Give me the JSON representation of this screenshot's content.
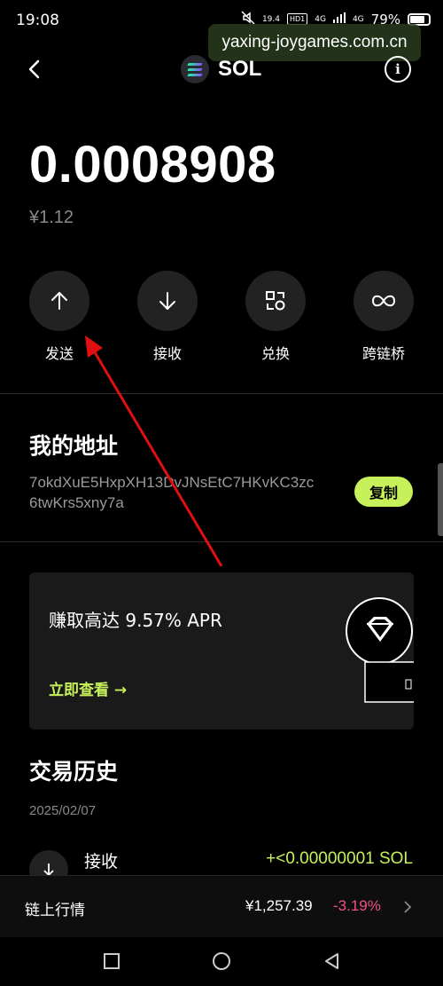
{
  "status_bar": {
    "time": "19:08",
    "net_speed": "19.4",
    "hd_label": "HD1",
    "signal1": "4G",
    "signal2": "4G",
    "battery": "79%"
  },
  "watermark": "yaxing-joygames.com.cn",
  "header": {
    "token_name": "SOL",
    "info_icon": "i"
  },
  "balance": {
    "amount": "0.0008908",
    "fiat": "¥1.12"
  },
  "actions": [
    {
      "label": "发送",
      "icon": "arrow-up-icon"
    },
    {
      "label": "接收",
      "icon": "arrow-down-icon"
    },
    {
      "label": "兑换",
      "icon": "swap-icon"
    },
    {
      "label": "跨链桥",
      "icon": "bridge-icon"
    }
  ],
  "address": {
    "title": "我的地址",
    "value": "7okdXuE5HxpXH13DvJNsEtC7HKvKC3zc6twKrs5xny7a",
    "copy_label": "复制"
  },
  "promo": {
    "title": "赚取高达 9.57% APR",
    "link_label": "立即查看 →"
  },
  "history": {
    "title": "交易历史",
    "date": "2025/02/07",
    "items": [
      {
        "type": "接收",
        "amount": "+<0.00000001 SOL"
      }
    ]
  },
  "market": {
    "label": "链上行情",
    "price": "¥1,257.39",
    "change": "-3.19%"
  },
  "colors": {
    "accent": "#c6f15a",
    "negative": "#f0508a",
    "annotation_arrow": "#e01010"
  }
}
